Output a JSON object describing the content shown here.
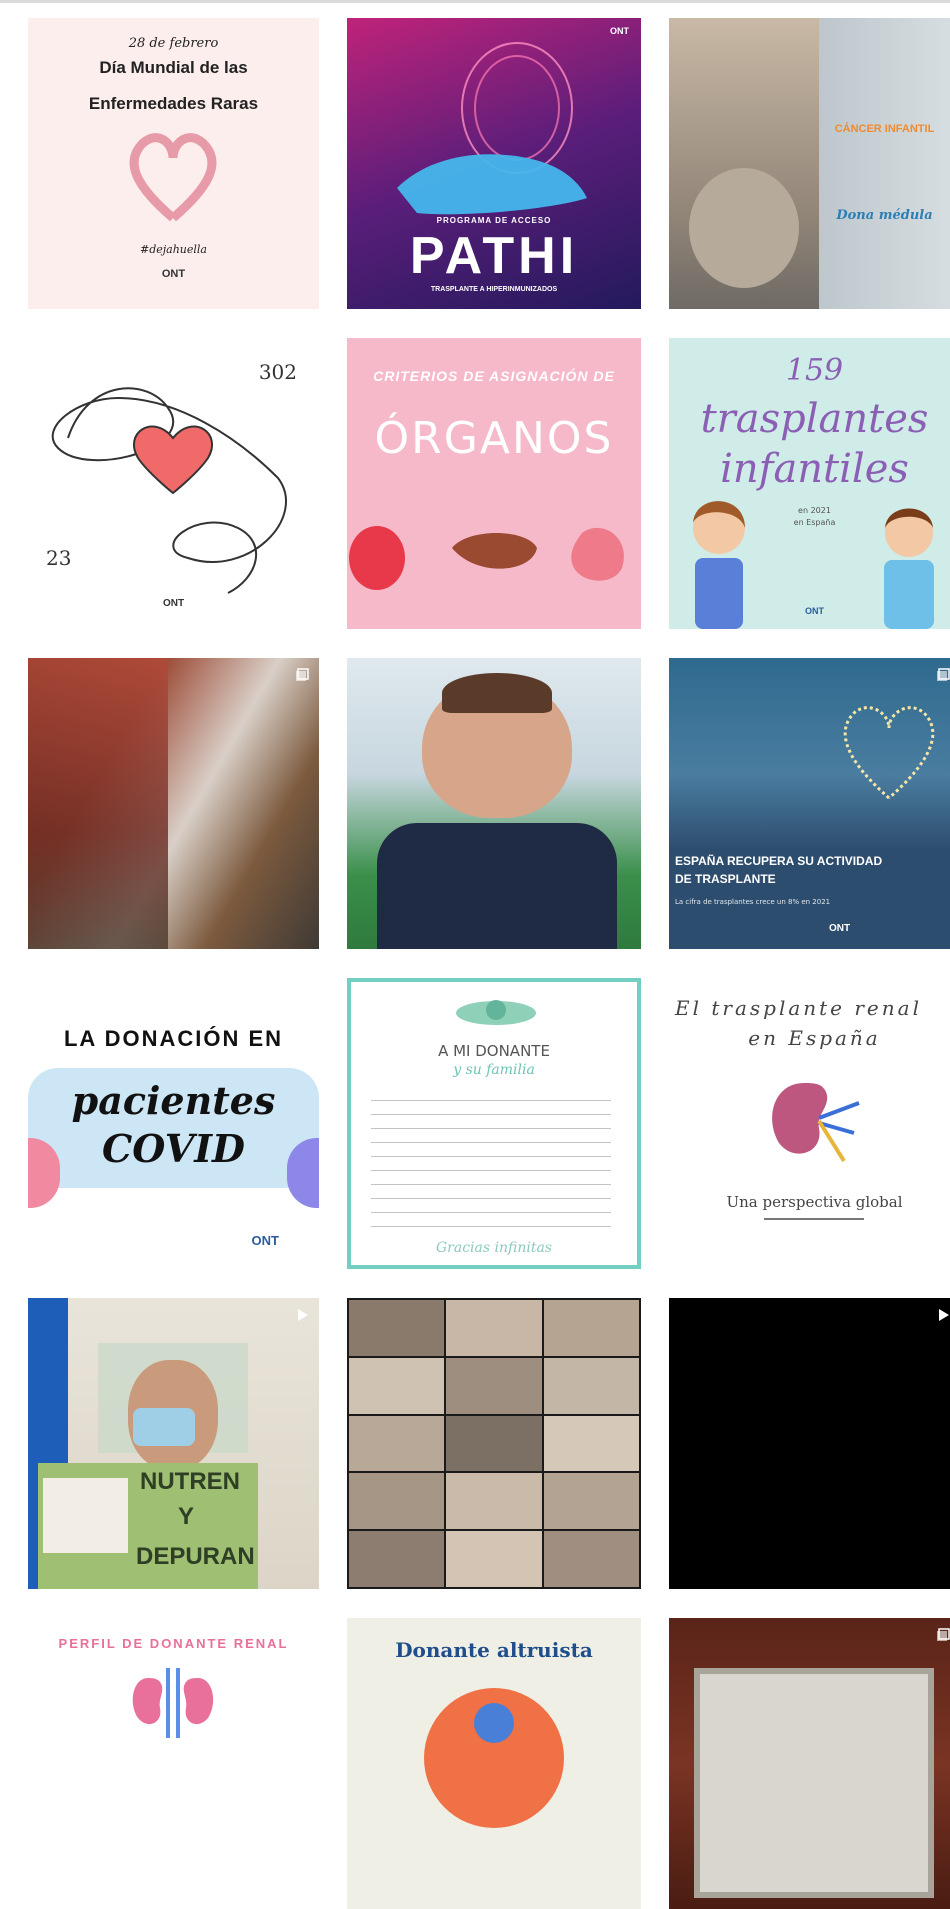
{
  "posts": {
    "p1": {
      "date": "28 de febrero",
      "title_l1": "Día Mundial de las",
      "title_l2": "Enfermedades Raras",
      "hashtag": "#dejahuella",
      "logo": "ONT"
    },
    "p2": {
      "subtitle": "PROGRAMA DE ACCESO",
      "title": "PATHI",
      "caption": "TRASPLANTE A HIPERINMUNIZADOS",
      "logo": "ONT"
    },
    "p3": {
      "l1": "CÁNCER INFANTIL",
      "l2": "Dona médula"
    },
    "p4": {
      "top_number": "302",
      "bottom_number": "23",
      "logo": "ONT"
    },
    "p5": {
      "l1": "CRITERIOS DE ASIGNACIÓN DE",
      "l2": "ÓRGANOS"
    },
    "p6": {
      "number": "159",
      "l1": "trasplantes",
      "l2": "infantiles",
      "l3": "en 2021",
      "l4": "en España",
      "logo": "ONT"
    },
    "p7": {},
    "p8": {},
    "p9": {
      "l1": "ESPAÑA RECUPERA SU ACTIVIDAD",
      "l2": "DE TRASPLANTE",
      "l3": "La cifra de trasplantes crece un 8% en 2021",
      "logo": "ONT"
    },
    "p10": {
      "l1": "LA DONACIÓN EN",
      "l2": "pacientes",
      "l3": "COVID",
      "logo": "ONT"
    },
    "p11": {
      "l1": "A MI DONANTE",
      "l2": "y su familia",
      "l3": "Gracias infinitas"
    },
    "p12": {
      "l1": "El trasplante renal",
      "l2": "en España",
      "l3": "Una perspectiva global"
    },
    "p13": {
      "l1": "NUTREN",
      "l2": "Y",
      "l3": "DEPURAN"
    },
    "p14": {},
    "p15": {},
    "p16": {
      "l1": "PERFIL DE DONANTE RENAL"
    },
    "p17": {
      "l1": "Donante altruista"
    },
    "p18": {}
  },
  "colors": {
    "pink_light": "#fbe9ea",
    "purple": "#2f1f6b",
    "mint": "#cfece8",
    "pink": "#f4b8c8",
    "navy": "#2d4d6e",
    "black": "#000000"
  }
}
